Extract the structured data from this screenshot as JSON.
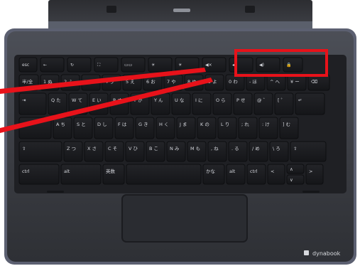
{
  "keyboard": {
    "brand_logo_text": "dynabook",
    "rows": [
      [
        "esc",
        "←",
        "↻",
        "⛶",
        "▭▭",
        "☀",
        "☀",
        "◀×",
        "◀",
        "◀)",
        "🔒"
      ],
      [
        "半/全",
        "1 ぬ",
        "2 ふ",
        "3 あ",
        "4 う",
        "5 え",
        "6 お",
        "7 や",
        "8 ゆ",
        "9 よ",
        "0 わ",
        "- ほ",
        "^ へ",
        "¥ ー",
        "⌫"
      ],
      [
        "⇥",
        "Q た",
        "W て",
        "E い",
        "R す",
        "T か",
        "Y ん",
        "U な",
        "I に",
        "O ら",
        "P せ",
        "@ ゛",
        "[ ゜",
        "↵"
      ],
      [
        "◉",
        "A ち",
        "S と",
        "D し",
        "F は",
        "G き",
        "H く",
        "J ま",
        "K の",
        "L り",
        "; れ",
        ": け",
        "] む"
      ],
      [
        "⇧",
        "Z つ",
        "X さ",
        "C そ",
        "V ひ",
        "B こ",
        "N み",
        "M も",
        ", ね",
        ". る",
        "/ め",
        "\\ ろ",
        "⇧"
      ],
      [
        "ctrl",
        "alt",
        "英数",
        "",
        "かな",
        "alt",
        "ctrl",
        "<",
        "∧",
        "∨",
        ">"
      ]
    ]
  },
  "annotation": {
    "highlight_color": "#e8121a",
    "line_color": "#e8121a"
  }
}
